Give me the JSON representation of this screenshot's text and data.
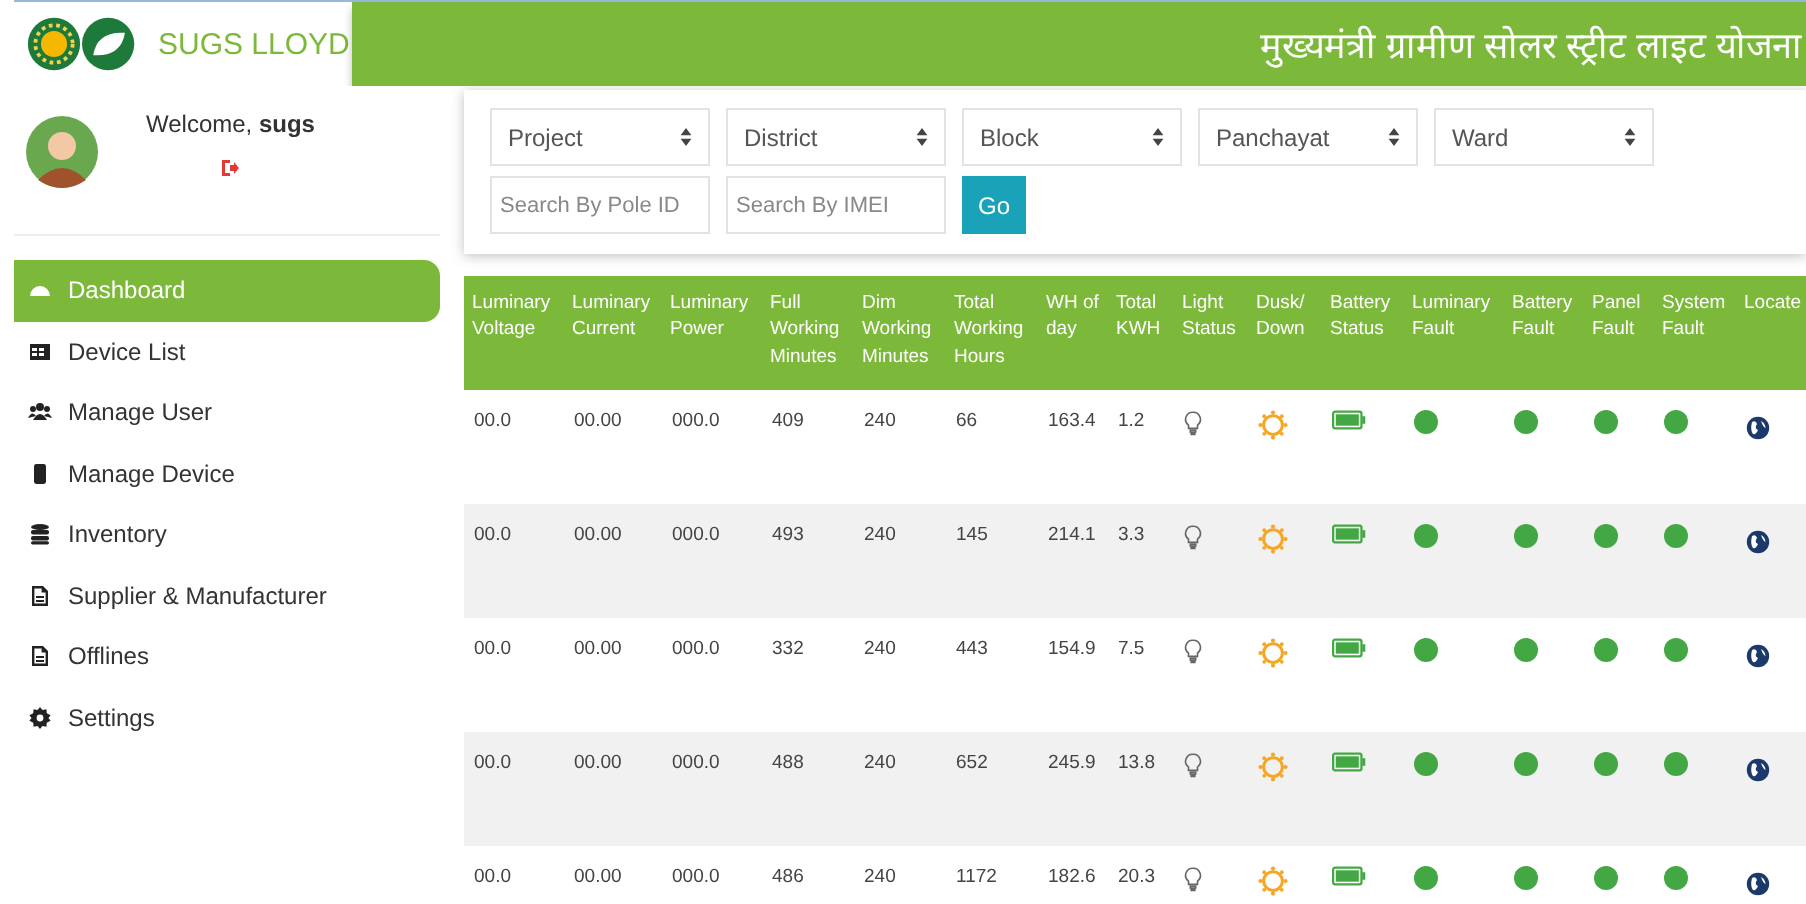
{
  "brand": {
    "name": "SUGS LLOYD"
  },
  "header": {
    "title": "मुख्यमंत्री ग्रामीण सोलर स्ट्रीट लाइट योजना"
  },
  "user": {
    "welcome": "Welcome, **sugs**"
  },
  "sidebar": {
    "items": [
      {
        "label": "Dashboard",
        "kind": "dashboard",
        "selected": true
      },
      {
        "label": "Device List",
        "kind": "table",
        "selected": false
      },
      {
        "label": "Manage User",
        "kind": "users",
        "selected": false
      },
      {
        "label": "Manage Device",
        "kind": "device",
        "selected": false
      },
      {
        "label": "Inventory",
        "kind": "database",
        "selected": false
      },
      {
        "label": "Supplier & Manufacturer",
        "kind": "file",
        "selected": false
      },
      {
        "label": "Offlines",
        "kind": "file",
        "selected": false
      },
      {
        "label": "Settings",
        "kind": "gear",
        "selected": false
      }
    ]
  },
  "filters": {
    "selects": [
      "Project",
      "District",
      "Block",
      "Panchayat",
      "Ward"
    ],
    "search_fields": [
      {
        "placeholder": "Search By Pole ID"
      },
      {
        "placeholder": "Search By IMEI"
      }
    ],
    "button": "Go"
  },
  "table": {
    "columns": [
      "Luminary Voltage",
      "Luminary Current",
      "Luminary Power",
      "Full Working Minutes",
      "Dim Working Minutes",
      "Total Working Hours",
      "WH of day",
      "Total KWH",
      "Light Status",
      "Dusk/ Down",
      "Battery Status",
      "Luminary Fault",
      "Battery Fault",
      "Panel Fault",
      "System Fault",
      "Locate"
    ],
    "rows": [
      {
        "cells": [
          "00.0",
          "00.00",
          "000.0",
          "409",
          "240",
          "66",
          "163.4",
          "1.2"
        ],
        "faults": [
          {
            "color": "#43a843"
          },
          {
            "color": "#43a843"
          },
          {
            "color": "#43a843"
          },
          {
            "color": "#43a843"
          }
        ]
      },
      {
        "cells": [
          "00.0",
          "00.00",
          "000.0",
          "493",
          "240",
          "145",
          "214.1",
          "3.3"
        ],
        "faults": [
          {
            "color": "#43a843"
          },
          {
            "color": "#43a843"
          },
          {
            "color": "#43a843"
          },
          {
            "color": "#43a843"
          }
        ]
      },
      {
        "cells": [
          "00.0",
          "00.00",
          "000.0",
          "332",
          "240",
          "443",
          "154.9",
          "7.5"
        ],
        "faults": [
          {
            "color": "#43a843"
          },
          {
            "color": "#43a843"
          },
          {
            "color": "#43a843"
          },
          {
            "color": "#43a843"
          }
        ]
      },
      {
        "cells": [
          "00.0",
          "00.00",
          "000.0",
          "488",
          "240",
          "652",
          "245.9",
          "13.8"
        ],
        "faults": [
          {
            "color": "#43a843"
          },
          {
            "color": "#43a843"
          },
          {
            "color": "#43a843"
          },
          {
            "color": "#43a843"
          }
        ]
      },
      {
        "cells": [
          "00.0",
          "00.00",
          "000.0",
          "486",
          "240",
          "1172",
          "182.6",
          "20.3"
        ],
        "faults": [
          {
            "color": "#43a843"
          },
          {
            "color": "#43a843"
          },
          {
            "color": "#43a843"
          },
          {
            "color": "#43a843"
          }
        ]
      }
    ]
  }
}
